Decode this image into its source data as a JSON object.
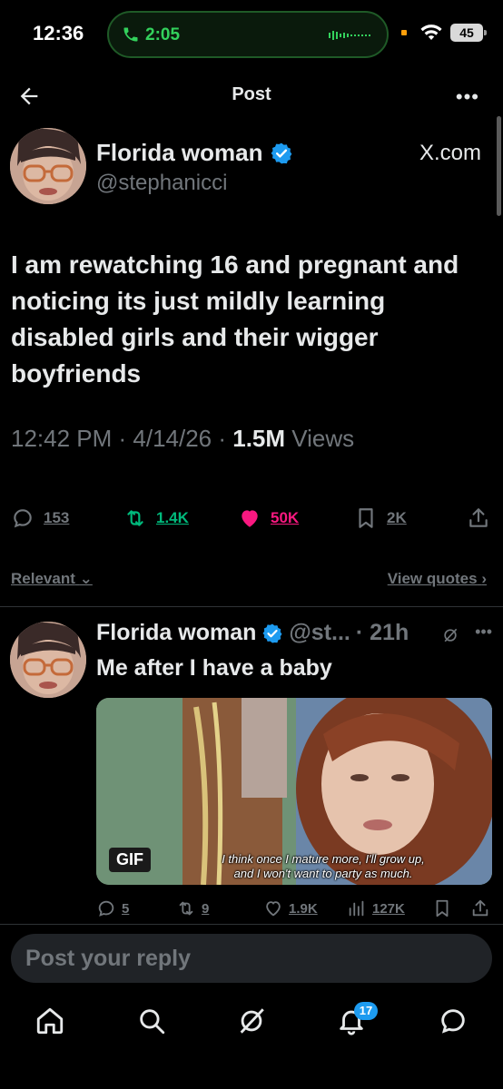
{
  "status_bar": {
    "time": "12:36",
    "call_duration": "2:05",
    "battery": "45"
  },
  "header": {
    "title": "Post"
  },
  "post": {
    "author_name": "Florida woman",
    "author_handle": "@stephanicci",
    "source_label": "X.com",
    "text": "I am rewatching 16 and pregnant and noticing its just mildly learning disabled girls and their wigger boyfriends",
    "timestamp": "12:42 PM · 4/14/26 · ",
    "views_count": "1.5M",
    "views_label": " Views",
    "stats": {
      "replies": "153",
      "reposts": "1.4K",
      "likes": "50K",
      "bookmarks": "2K"
    }
  },
  "sort": {
    "relevant_label": "Relevant",
    "view_quotes_label": "View quotes"
  },
  "reply": {
    "author_name": "Florida woman",
    "author_handle": "@st...",
    "time": "· 21h",
    "text": "Me after I have a baby",
    "gif_badge": "GIF",
    "gif_caption_line1": "I think once I mature more, I'll grow up,",
    "gif_caption_line2": "and I won't want to party as much.",
    "stats": {
      "replies": "5",
      "reposts": "9",
      "likes": "1.9K",
      "views": "127K"
    }
  },
  "composer": {
    "placeholder": "Post your reply"
  },
  "tabbar": {
    "notification_count": "17"
  },
  "colors": {
    "background": "#000000",
    "text_primary": "#e7e9ea",
    "text_secondary": "#71767b",
    "repost_green": "#00ba7c",
    "like_pink": "#f91880",
    "verified_blue": "#1d9bf0",
    "call_green": "#33d15c"
  }
}
